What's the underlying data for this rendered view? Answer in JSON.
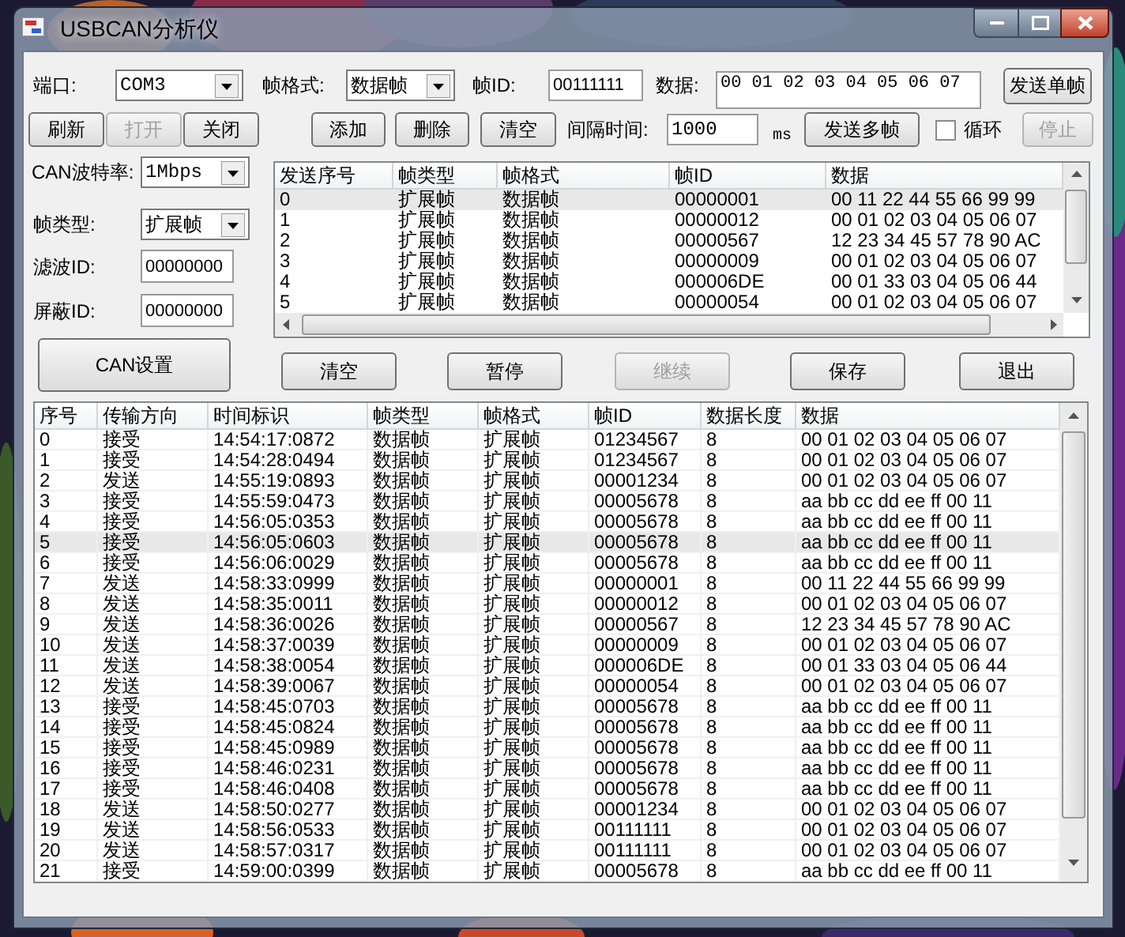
{
  "window": {
    "title": "USBCAN分析仪"
  },
  "port": {
    "label": "端口:",
    "value": "COM3"
  },
  "frame_format": {
    "label": "帧格式:",
    "value": "数据帧"
  },
  "frame_id": {
    "label": "帧ID:",
    "value": "00111111"
  },
  "data": {
    "label": "数据:",
    "value": "00 01 02 03 04 05 06 07"
  },
  "send_single_button": {
    "label": "发送单帧",
    "disabled": false
  },
  "port_buttons": [
    {
      "label": "刷新",
      "disabled": false
    },
    {
      "label": "打开",
      "disabled": true
    },
    {
      "label": "关闭",
      "disabled": false
    }
  ],
  "list_buttons": [
    {
      "label": "添加",
      "disabled": false
    },
    {
      "label": "删除",
      "disabled": false
    },
    {
      "label": "清空",
      "disabled": false
    }
  ],
  "interval": {
    "label": "间隔时间:",
    "value": "1000",
    "unit": "ms"
  },
  "send_multi_button": {
    "label": "发送多帧",
    "disabled": false
  },
  "loop": {
    "label": "循环",
    "checked": false
  },
  "stop_button": {
    "label": "停止",
    "disabled": true
  },
  "baud_rate": {
    "label": "CAN波特率:",
    "value": "1Mbps"
  },
  "frame_type": {
    "label": "帧类型:",
    "value": "扩展帧"
  },
  "filter_id": {
    "label": "滤波ID:",
    "value": "00000000"
  },
  "mask_id": {
    "label": "屏蔽ID:",
    "value": "00000000"
  },
  "can_settings_button": {
    "label": "CAN设置",
    "disabled": false
  },
  "send_list": {
    "columns": [
      "发送序号",
      "帧类型",
      "帧格式",
      "帧ID",
      "数据"
    ],
    "rows": [
      {
        "cells": [
          "0",
          "扩展帧",
          "数据帧",
          "00000001",
          "00 11 22 44 55 66 99 99"
        ],
        "selected": true
      },
      {
        "cells": [
          "1",
          "扩展帧",
          "数据帧",
          "00000012",
          "00 01 02 03 04 05 06 07"
        ],
        "selected": false
      },
      {
        "cells": [
          "2",
          "扩展帧",
          "数据帧",
          "00000567",
          "12 23 34 45 57 78 90 AC"
        ],
        "selected": false
      },
      {
        "cells": [
          "3",
          "扩展帧",
          "数据帧",
          "00000009",
          "00 01 02 03 04 05 06 07"
        ],
        "selected": false
      },
      {
        "cells": [
          "4",
          "扩展帧",
          "数据帧",
          "000006DE",
          "00 01 33 03 04 05 06 44"
        ],
        "selected": false
      },
      {
        "cells": [
          "5",
          "扩展帧",
          "数据帧",
          "00000054",
          "00 01 02 03 04 05 06 07"
        ],
        "selected": false
      }
    ]
  },
  "action_buttons": [
    {
      "label": "清空",
      "disabled": false
    },
    {
      "label": "暂停",
      "disabled": false
    },
    {
      "label": "继续",
      "disabled": true
    },
    {
      "label": "保存",
      "disabled": false
    },
    {
      "label": "退出",
      "disabled": false
    }
  ],
  "log": {
    "columns": [
      "序号",
      "传输方向",
      "时间标识",
      "帧类型",
      "帧格式",
      "帧ID",
      "数据长度",
      "数据"
    ],
    "rows": [
      {
        "cells": [
          "0",
          "接受",
          "14:54:17:0872",
          "数据帧",
          "扩展帧",
          "01234567",
          "8",
          "00 01 02 03 04 05 06 07"
        ],
        "selected": false
      },
      {
        "cells": [
          "1",
          "接受",
          "14:54:28:0494",
          "数据帧",
          "扩展帧",
          "01234567",
          "8",
          "00 01 02 03 04 05 06 07"
        ],
        "selected": false
      },
      {
        "cells": [
          "2",
          "发送",
          "14:55:19:0893",
          "数据帧",
          "扩展帧",
          "00001234",
          "8",
          "00 01 02 03 04 05 06 07"
        ],
        "selected": false
      },
      {
        "cells": [
          "3",
          "接受",
          "14:55:59:0473",
          "数据帧",
          "扩展帧",
          "00005678",
          "8",
          "aa bb cc dd ee ff 00 11"
        ],
        "selected": false
      },
      {
        "cells": [
          "4",
          "接受",
          "14:56:05:0353",
          "数据帧",
          "扩展帧",
          "00005678",
          "8",
          "aa bb cc dd ee ff 00 11"
        ],
        "selected": false
      },
      {
        "cells": [
          "5",
          "接受",
          "14:56:05:0603",
          "数据帧",
          "扩展帧",
          "00005678",
          "8",
          "aa bb cc dd ee ff 00 11"
        ],
        "selected": true
      },
      {
        "cells": [
          "6",
          "接受",
          "14:56:06:0029",
          "数据帧",
          "扩展帧",
          "00005678",
          "8",
          "aa bb cc dd ee ff 00 11"
        ],
        "selected": false
      },
      {
        "cells": [
          "7",
          "发送",
          "14:58:33:0999",
          "数据帧",
          "扩展帧",
          "00000001",
          "8",
          "00 11 22 44 55 66 99 99"
        ],
        "selected": false
      },
      {
        "cells": [
          "8",
          "发送",
          "14:58:35:0011",
          "数据帧",
          "扩展帧",
          "00000012",
          "8",
          "00 01 02 03 04 05 06 07"
        ],
        "selected": false
      },
      {
        "cells": [
          "9",
          "发送",
          "14:58:36:0026",
          "数据帧",
          "扩展帧",
          "00000567",
          "8",
          "12 23 34 45 57 78 90 AC"
        ],
        "selected": false
      },
      {
        "cells": [
          "10",
          "发送",
          "14:58:37:0039",
          "数据帧",
          "扩展帧",
          "00000009",
          "8",
          "00 01 02 03 04 05 06 07"
        ],
        "selected": false
      },
      {
        "cells": [
          "11",
          "发送",
          "14:58:38:0054",
          "数据帧",
          "扩展帧",
          "000006DE",
          "8",
          "00 01 33 03 04 05 06 44"
        ],
        "selected": false
      },
      {
        "cells": [
          "12",
          "发送",
          "14:58:39:0067",
          "数据帧",
          "扩展帧",
          "00000054",
          "8",
          "00 01 02 03 04 05 06 07"
        ],
        "selected": false
      },
      {
        "cells": [
          "13",
          "接受",
          "14:58:45:0703",
          "数据帧",
          "扩展帧",
          "00005678",
          "8",
          "aa bb cc dd ee ff 00 11"
        ],
        "selected": false
      },
      {
        "cells": [
          "14",
          "接受",
          "14:58:45:0824",
          "数据帧",
          "扩展帧",
          "00005678",
          "8",
          "aa bb cc dd ee ff 00 11"
        ],
        "selected": false
      },
      {
        "cells": [
          "15",
          "接受",
          "14:58:45:0989",
          "数据帧",
          "扩展帧",
          "00005678",
          "8",
          "aa bb cc dd ee ff 00 11"
        ],
        "selected": false
      },
      {
        "cells": [
          "16",
          "接受",
          "14:58:46:0231",
          "数据帧",
          "扩展帧",
          "00005678",
          "8",
          "aa bb cc dd ee ff 00 11"
        ],
        "selected": false
      },
      {
        "cells": [
          "17",
          "接受",
          "14:58:46:0408",
          "数据帧",
          "扩展帧",
          "00005678",
          "8",
          "aa bb cc dd ee ff 00 11"
        ],
        "selected": false
      },
      {
        "cells": [
          "18",
          "发送",
          "14:58:50:0277",
          "数据帧",
          "扩展帧",
          "00001234",
          "8",
          "00 01 02 03 04 05 06 07"
        ],
        "selected": false
      },
      {
        "cells": [
          "19",
          "发送",
          "14:58:56:0533",
          "数据帧",
          "扩展帧",
          "00111111",
          "8",
          "00 01 02 03 04 05 06 07"
        ],
        "selected": false
      },
      {
        "cells": [
          "20",
          "发送",
          "14:58:57:0317",
          "数据帧",
          "扩展帧",
          "00111111",
          "8",
          "00 01 02 03 04 05 06 07"
        ],
        "selected": false
      },
      {
        "cells": [
          "21",
          "接受",
          "14:59:00:0399",
          "数据帧",
          "扩展帧",
          "00005678",
          "8",
          "aa bb cc dd ee ff 00 11"
        ],
        "selected": false
      }
    ]
  }
}
